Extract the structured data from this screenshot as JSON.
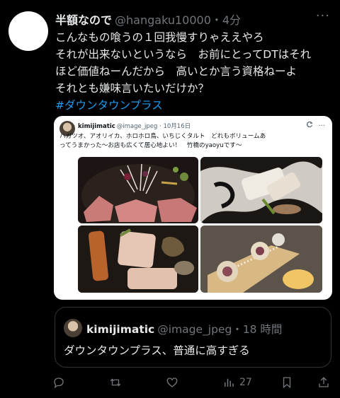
{
  "tweet": {
    "name": "半額なので",
    "handle": "@hangaku10000・4分",
    "more_icon": "more-icon",
    "lines": [
      "こんなもの喰うの１回我慢すりゃええやろ",
      "それが出来ないというなら　お前にとってDTはそれ",
      "ほど価値ねーんだから　高いとか言う資格ねーよ",
      "それとも嫌味言いたいだけか？"
    ],
    "hashtag": "#ダウンタウンプラス"
  },
  "image_card": {
    "name": "kimijimatic",
    "handle": "@image_jpeg · 10月16日",
    "lines": [
      "ハガツオ、アオリイカ、ホロホロ鳥、いちじくタルト　どれもボリュームあ",
      "ってうまかった〜お店も広くて居心地よい！　竹橋のyaoyuです〜"
    ]
  },
  "quote": {
    "name": "kimijimatic",
    "handle": "@image_jpeg・18 時間",
    "text": "ダウンタウンプラス、普通に高すぎる"
  },
  "actions": {
    "reply_icon": "reply-icon",
    "retweet_icon": "retweet-icon",
    "like_icon": "heart-icon",
    "views_icon": "views-icon",
    "views_count": "27",
    "bookmark_icon": "bookmark-icon",
    "share_icon": "share-icon"
  },
  "colors": {
    "background": "#000000",
    "text": "#e7e9ea",
    "muted": "#71767b",
    "accent": "#1d9bf0"
  }
}
